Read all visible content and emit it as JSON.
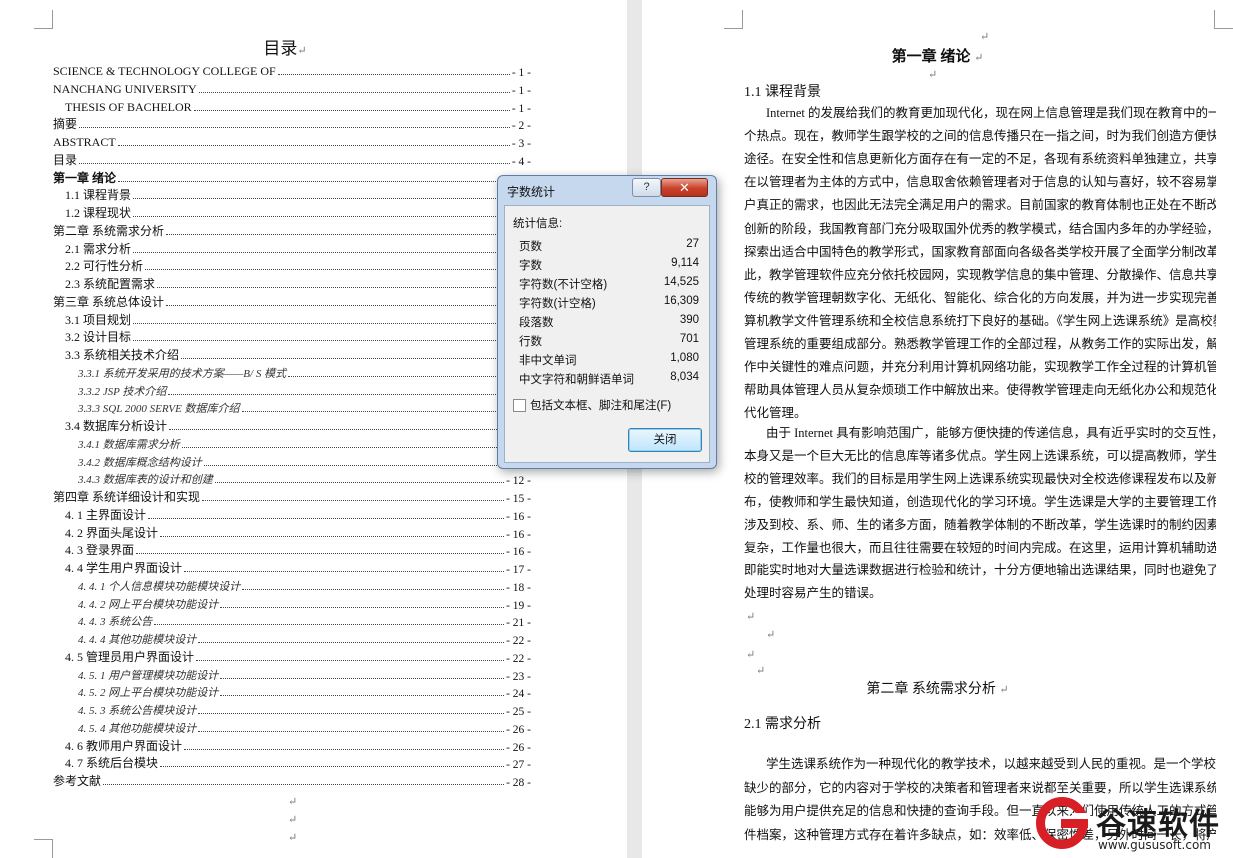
{
  "toc": {
    "title": "目录",
    "entries": [
      {
        "text": "SCIENCE & TECHNOLOGY COLLEGE OF",
        "page": "- 1 -"
      },
      {
        "text": "NANCHANG    UNIVERSITY",
        "page": "- 1 -"
      },
      {
        "text": "THESIS   OF   BACHELOR",
        "page": "- 1 -"
      },
      {
        "text": "摘要",
        "page": "- 2 -"
      },
      {
        "text": "ABSTRACT",
        "page": "- 3 -"
      },
      {
        "text": "目录",
        "page": "- 4 -"
      },
      {
        "text": "第一章  绪论",
        "page": "- 5 -"
      },
      {
        "text": "1.1 课程背景",
        "page": "- 5 -"
      },
      {
        "text": "1.2 课程现状",
        "page": "- 6 -"
      },
      {
        "text": "第二章    系统需求分析",
        "page": "- 6 -"
      },
      {
        "text": "2.1 需求分析",
        "page": "- 6 -"
      },
      {
        "text": "2.2 可行性分析",
        "page": "- 7 -"
      },
      {
        "text": "2.3 系统配置需求",
        "page": "- 8 -"
      },
      {
        "text": "第三章    系统总体设计",
        "page": "- 8 -"
      },
      {
        "text": "3.1 项目规划",
        "page": "- 8 -"
      },
      {
        "text": "3.2 设计目标",
        "page": "- 9 -"
      },
      {
        "text": "3.3 系统相关技术介绍",
        "page": "- 9 -"
      },
      {
        "text": "3.3.1 系统开发采用的技术方案——B/ S 模式",
        "page": "- 9 -"
      },
      {
        "text": "3.3.2 JSP 技术介绍",
        "page": "- 10 -"
      },
      {
        "text": "3.3.3    SQL 2000 SERVE  数据库介绍",
        "page": "- 10 -"
      },
      {
        "text": "3.4 数据库分析设计",
        "page": "- 11 -"
      },
      {
        "text": "3.4.1  数据库需求分析",
        "page": "- 11 -"
      },
      {
        "text": "3.4.2  数据库概念结构设计",
        "page": "- 11 -"
      },
      {
        "text": "3.4.3  数据库表的设计和创建",
        "page": "- 12 -"
      },
      {
        "text": "第四章  系统详细设计和实现",
        "page": "- 15 -"
      },
      {
        "text": "4. 1 主界面设计",
        "page": "- 16 -"
      },
      {
        "text": "4. 2 界面头尾设计",
        "page": "- 16 -"
      },
      {
        "text": "4. 3 登录界面",
        "page": "- 16 -"
      },
      {
        "text": "4. 4 学生用户界面设计",
        "page": "- 17 -"
      },
      {
        "text": "4. 4. 1  个人信息模块功能模块设计",
        "page": "- 18 -"
      },
      {
        "text": "4. 4. 2  网上平台模块功能设计",
        "page": "- 19 -"
      },
      {
        "text": "4. 4. 3  系统公告",
        "page": "- 21 -"
      },
      {
        "text": "4. 4. 4  其他功能模块设计",
        "page": "- 22 -"
      },
      {
        "text": "4. 5 管理员用户界面设计",
        "page": "- 22 -"
      },
      {
        "text": "4. 5. 1 用户管理模块功能设计",
        "page": "- 23 -"
      },
      {
        "text": "4. 5. 2  网上平台模块功能设计",
        "page": "- 24 -"
      },
      {
        "text": "4. 5. 3  系统公告模块设计",
        "page": "- 25 -"
      },
      {
        "text": "4. 5. 4  其他功能模块设计",
        "page": "- 26 -"
      },
      {
        "text": "4. 6 教师用户界面设计",
        "page": "- 26 -"
      },
      {
        "text": "4. 7 系统后台模块",
        "page": "- 27 -"
      },
      {
        "text": "参考文献",
        "page": "- 28 -"
      }
    ]
  },
  "right_page": {
    "chapter1_title": "第一章  绪论",
    "sec1_1": "1.1  课程背景",
    "p1_lines": [
      "Internet 的发展给我们的教育更加现代化，现在网上信息管理是我们现在教育中的一",
      "个热点。现在，教师学生跟学校的之间的信息传播只在一指之间，时为我们创造方便快速的",
      "途径。在安全性和信息更新化方面存在有一定的不足，各现有系统资料单独建立，共享性差；",
      "在以管理者为主体的方式中，信息取舍依赖管理者对于信息的认知与喜好，较不容易掌握用",
      "户真正的需求，也因此无法完全满足用户的需求。目前国家的教育体制也正处在不断改革、",
      "创新的阶段，我国教育部门充分吸取国外优秀的教学模式，结合国内多年的办学经验，逐步",
      "探索出适合中国特色的教学形式，国家教育部面向各级各类学校开展了全面学分制改革。因",
      "此，教学管理软件应充分依托校园网，实现教学信息的集中管理、分散操作、信息共享，使",
      "传统的教学管理朝数字化、无纸化、智能化、综合化的方向发展，并为进一步实现完善的计",
      "算机教学文件管理系统和全校信息系统打下良好的基础。《学生网上选课系统》是高校教学",
      "管理系统的重要组成部分。熟悉教学管理工作的全部过程，从教务工作的实际出发，解决工",
      "作中关键性的难点问题，并充分利用计算机网络功能，实现教学工作全过程的计算机管理，",
      "帮助具体管理人员从复杂烦琐工作中解放出来。使得教学管理走向无纸化办公和规范化、现",
      "代化管理。"
    ],
    "p2_lines": [
      "由于 Internet 具有影响范围广，能够方便快捷的传递信息，具有近乎实时的交互性，",
      "本身又是一个巨大无比的信息库等诸多优点。学生网上选课系统，可以提高教师，学生和学",
      "校的管理效率。我们的目标是用学生网上选课系统实现最快对全校选修课程发布以及新闻发",
      "布，使教师和学生最快知道，创造现代化的学习环境。学生选课是大学的主要管理工作之一，",
      "涉及到校、系、师、生的诸多方面，随着教学体制的不断改革，学生选课时的制约因素比较",
      "复杂，工作量也很大，而且往往需要在较短的时间内完成。在这里，运用计算机辅助选课，",
      "即能实时地对大量选课数据进行检验和统计，十分方便地输出选课结果，同时也避免了人工",
      "处理时容易产生的错误。"
    ],
    "chapter2_title": "第二章    系统需求分析",
    "sec2_1": "2.1  需求分析",
    "p3_lines": [
      "学生选课系统作为一种现代化的教学技术，以越来越受到人民的重视。是一个学校不可",
      "缺少的部分，它的内容对于学校的决策者和管理者来说都至关重要，所以学生选课系统应该",
      "能够为用户提供充足的信息和快捷的查询手段。但一直以来人们使用传统人工的方式管理文",
      "件档案，这种管理方式存在着许多缺点，如：效率低、保密性差，另外时间一长，将产生大量"
    ]
  },
  "dialog": {
    "title": "字数统计",
    "help_label": "?",
    "close_label": "✕",
    "stats_label": "统计信息:",
    "stats": [
      {
        "label": "页数",
        "value": "27"
      },
      {
        "label": "字数",
        "value": "9,114"
      },
      {
        "label": "字符数(不计空格)",
        "value": "14,525"
      },
      {
        "label": "字符数(计空格)",
        "value": "16,309"
      },
      {
        "label": "段落数",
        "value": "390"
      },
      {
        "label": "行数",
        "value": "701"
      },
      {
        "label": "非中文单词",
        "value": "1,080"
      },
      {
        "label": "中文字符和朝鲜语单词",
        "value": "8,034"
      }
    ],
    "checkbox_label": "包括文本框、脚注和尾注(F)",
    "close_button": "关闭"
  },
  "watermark": {
    "name": "谷速软件",
    "url": "www.gususoft.com"
  }
}
